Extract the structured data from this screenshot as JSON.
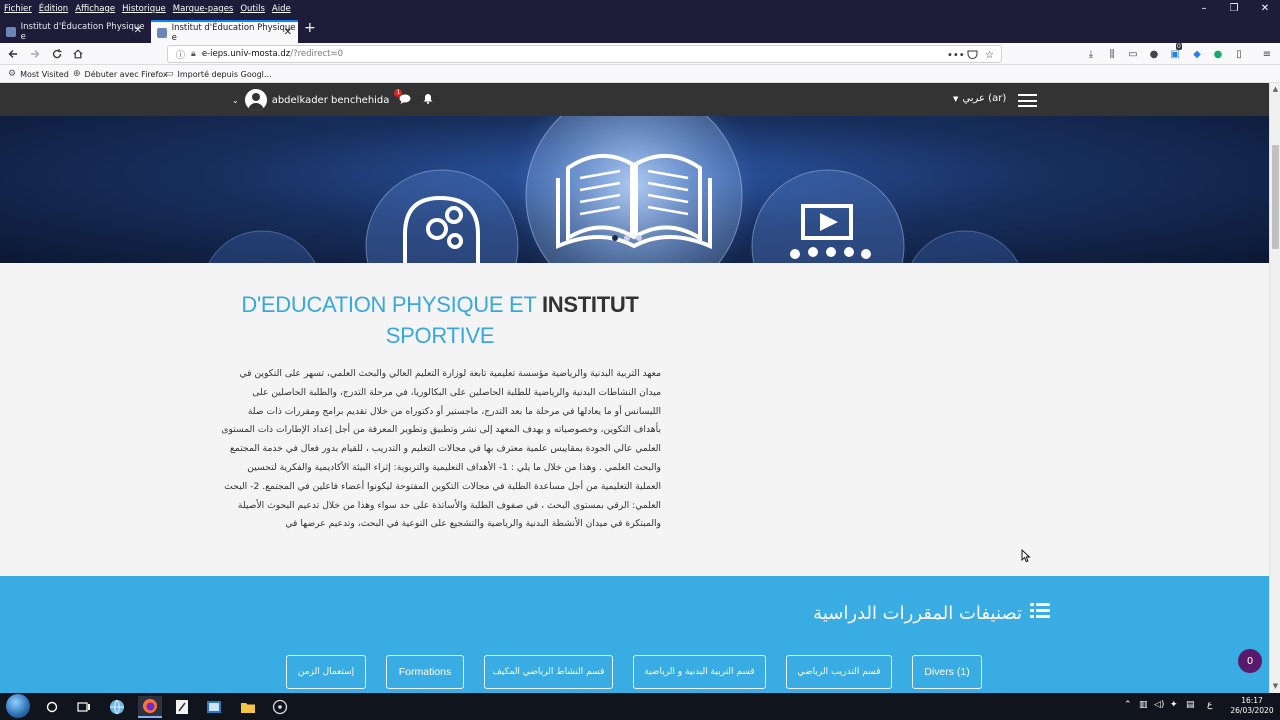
{
  "browser": {
    "menu": [
      "Fichier",
      "Édition",
      "Affichage",
      "Historique",
      "Marque-pages",
      "Outils",
      "Aide"
    ],
    "tabs": [
      {
        "title": "Institut d'Éducation Physique e"
      },
      {
        "title": "Institut d'Éducation Physique e"
      }
    ],
    "url_host": "e-ieps.univ-mosta.dz",
    "url_rest": "/?redirect=0",
    "bookmarks": [
      "Most Visited",
      "Débuter avec Firefox",
      "Importé depuis Googl..."
    ],
    "toolbar_badge": "0"
  },
  "site": {
    "user_name": "abdelkader benchehida",
    "message_badge": "1",
    "language": "عربي ‎(ar)‎",
    "banner_slide_count": 3,
    "banner_active_slide": 1
  },
  "about": {
    "title_light": "D'EDUCATION PHYSIQUE ET",
    "title_bold": "INSTITUT",
    "title_line2": "SPORTIVE",
    "body": "معهد التربية البدنية والرياضية مؤسسة تعليمية تابعة لوزارة التعليم العالي والبحث العلمي، تسهر على التكوين في ميدان النشاطات البدنية والرياضية للطلبة الحاصلين على البكالوريا، في مرحلة التدرج، والطلبة الحاصلين على الليسانس أو ما يعادلها في مرحلة ما بعد التدرج، ماجستير أو دكتوراه من خلال تقديم برامج ومقررات ذات صلة بأهداف التكوين، وخصوصياته  و يهدف المعهد إلى نشر وتطبيق وتطوير المعرفة من أجل إعداد الإطارات ذات المستوى العلمي عالي الجودة بمقاييس علمية معترف بها في مجالات التعليم و التدريب ، للقيام بدور فعال في خدمة المجتمع والبحث العلمي . وهذا من خلال ما يلي : 1- الأهداف التعليمية والتربوية: إثراء البيئة الأكاديمية والفكرية لتحسين العملية التعليمية  من أجل مساعدة الطلبة في مجالات التكوين المفتوحة ليكونوا أعضاء فاعلين في المجتمع. 2- البحث العلمي: الرقي بمستوى البحث ، في صفوف الطلبة والأساتذة على حد سواء وهذا من خلال تدعيم البحوث الأصيلة والمبتكرة في ميدان الأنشطة البدنية والرياضية  والتشجيع على النوعية في البحث، وتدعيم عرضها في"
  },
  "categories": {
    "title": "تصنيفات المقررات الدراسية",
    "buttons": [
      {
        "label": "Divers (1)",
        "latin": true
      },
      {
        "label": "قسم التدريب الرياضي",
        "latin": false
      },
      {
        "label": "قسم التربية البدنية و الرياضية",
        "latin": false
      },
      {
        "label": "قسم النشاط الرياضي المكيف",
        "latin": false
      },
      {
        "label": "Formations",
        "latin": true
      },
      {
        "label": "إستعمال الزمن",
        "latin": false
      }
    ]
  },
  "chat": {
    "count": "0"
  },
  "taskbar": {
    "time": "16:17",
    "date": "26/03/2020",
    "lang_indicator": "ع"
  },
  "colors": {
    "accent_blue": "#39ace3",
    "header_dark": "#333333",
    "title_blue": "#39a9dc",
    "chat_purple": "#5a1a6b"
  }
}
